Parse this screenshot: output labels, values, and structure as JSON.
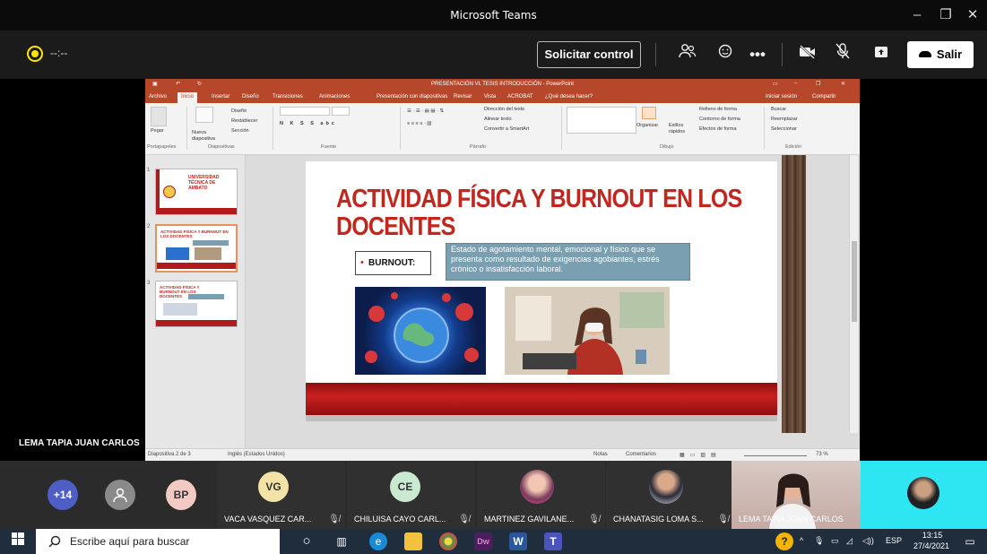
{
  "window": {
    "title": "Microsoft Teams",
    "minimize": "–",
    "restore": "❐",
    "close": "✕"
  },
  "callbar": {
    "timer": "--:--",
    "control_label": "Solicitar control",
    "leave_label": "Salir",
    "icons": [
      "people-icon",
      "chat-reaction-icon",
      "more-icon",
      "camera-off-icon",
      "mic-off-icon",
      "share-icon"
    ]
  },
  "powerpoint": {
    "title": "PRESENTACIÓN VL TESIS INTRODUCCIÓN - PowerPoint",
    "tabs": [
      "Archivo",
      "Inicio",
      "Insertar",
      "Diseño",
      "Transiciones",
      "Animaciones",
      "Presentación con diapositivas",
      "Revisar",
      "Vista",
      "ACROBAT",
      "¿Qué desea hacer?"
    ],
    "signin": "Iniciar sesión",
    "share": "Compartir",
    "ribbon": {
      "paste": "Pegar",
      "new_slide": "Nueva diapositiva",
      "layout": "Diseño",
      "reset": "Restablecer",
      "section": "Sección",
      "text_direction": "Dirección del texto",
      "align_text": "Alinear texto",
      "smartart": "Convertir a SmartArt",
      "arrange": "Organizar",
      "styles": "Estilos rápidos",
      "shape_fill": "Relleno de forma",
      "shape_outline": "Contorno de forma",
      "shape_effects": "Efectos de forma",
      "find": "Buscar",
      "replace": "Reemplazar",
      "select": "Seleccionar",
      "groups": [
        "Portapapeles",
        "Diapositivas",
        "Fuente",
        "Párrafo",
        "Dibujo",
        "Edición"
      ]
    },
    "thumbnails": [
      {
        "num": "1",
        "title": "UNIVERSIDAD TÉCNICA DE AMBATO"
      },
      {
        "num": "2",
        "title": "ACTIVIDAD FÍSICA Y BURNOUT EN LOS DOCENTES"
      },
      {
        "num": "3",
        "title": "ACTIVIDAD FÍSICA Y BURNOUT EN LOS DOCENTES"
      }
    ],
    "slide": {
      "title": "ACTIVIDAD FÍSICA Y BURNOUT EN LOS DOCENTES",
      "bullet": "•",
      "burnout_label": "BURNOUT:",
      "definition": "Estado de agotamiento mental, emocional y físico que se presenta como resultado de exigencias agobiantes, estrés crónico o insatisfacción laboral."
    },
    "status": {
      "slide_of": "Diapositiva 2 de 3",
      "language": "Inglés (Estados Unidos)",
      "notes": "Notas",
      "comments": "Comentarios",
      "zoom": "73 %"
    }
  },
  "presenter_name": "LEMA TAPIA JUAN CARLOS",
  "participants": {
    "overflow": "+14",
    "bp": "BP",
    "tiles": [
      {
        "initials": "VG",
        "name": "VACA VASQUEZ CAR...",
        "color": "#f4e3a7"
      },
      {
        "initials": "CE",
        "name": "CHILUISA CAYO CARL...",
        "color": "#c9ead0"
      },
      {
        "initials": "",
        "name": "MARTINEZ GAVILANE...",
        "color": ""
      },
      {
        "initials": "",
        "name": "CHANATASIG LOMA S...",
        "color": ""
      },
      {
        "initials": "",
        "name": "LEMA TAPIA JUAN CARLOS",
        "color": ""
      }
    ]
  },
  "taskbar": {
    "search_placeholder": "Escribe aquí para buscar",
    "tray_lang": "ESP",
    "time": "13:15",
    "date": "27/4/2021"
  }
}
